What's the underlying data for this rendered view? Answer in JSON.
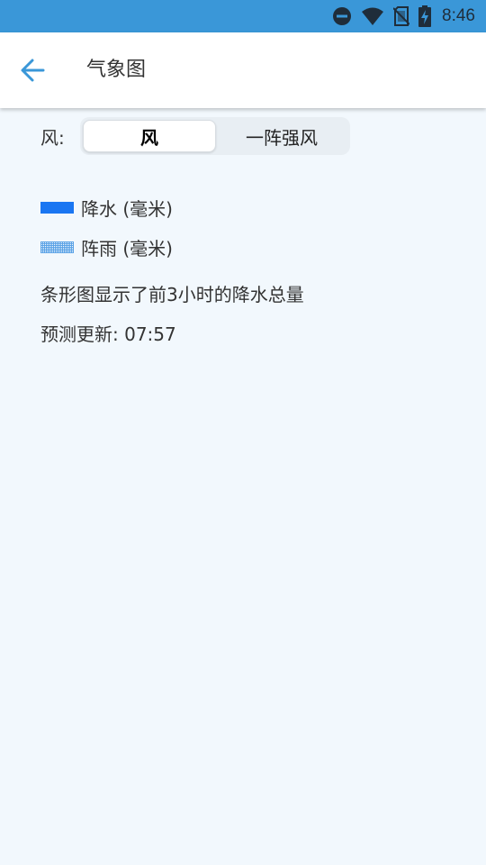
{
  "status_bar": {
    "time": "8:46",
    "icons": [
      "do-not-disturb-icon",
      "wifi-icon",
      "no-sim-icon",
      "battery-charging-icon"
    ],
    "background": "#3a97d8"
  },
  "app_bar": {
    "back_icon": "arrow-left-icon",
    "title": "气象图",
    "accent": "#3a97d8"
  },
  "wind": {
    "label": "风:",
    "options": [
      {
        "label": "风",
        "selected": true
      },
      {
        "label": "一阵强风",
        "selected": false
      }
    ]
  },
  "legend": {
    "items": [
      {
        "label": "降水 (毫米)",
        "color": "#1a76f2",
        "pattern": "solid"
      },
      {
        "label": "阵雨 (毫米)",
        "color": "#5aa2e6",
        "pattern": "dotted"
      }
    ]
  },
  "info": {
    "note": "条形图显示了前3小时的降水总量",
    "forecast_update": "预测更新: 07:57"
  }
}
